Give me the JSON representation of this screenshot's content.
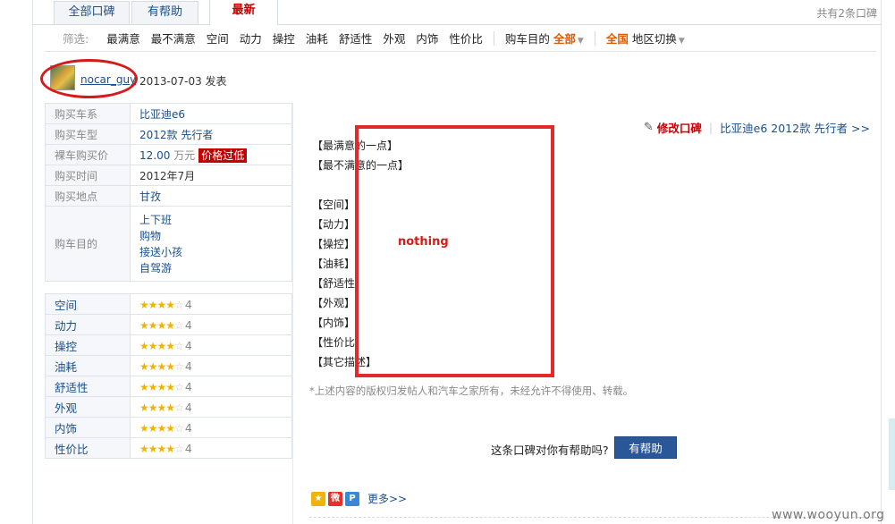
{
  "tabs": [
    {
      "label": "全部口碑",
      "active": false
    },
    {
      "label": "有帮助",
      "active": false
    },
    {
      "label": "最新",
      "active": true
    }
  ],
  "total_text": "共有2条口碑",
  "filter": {
    "label": "筛选:",
    "items": [
      "最满意",
      "最不满意",
      "空间",
      "动力",
      "操控",
      "油耗",
      "舒适性",
      "外观",
      "内饰",
      "性价比"
    ],
    "purpose_label": "购车目的",
    "purpose_value": "全部",
    "region_value": "全国",
    "region_switch": "地区切换"
  },
  "user": {
    "name": "nocar_guy",
    "date": "2013-07-03 发表"
  },
  "info": {
    "series_label": "购买车系",
    "series_value": "比亚迪e6",
    "model_label": "购买车型",
    "model_value": "2012款 先行者",
    "price_label": "裸车购买价",
    "price_value": "12.00",
    "price_unit": "万元",
    "price_badge": "价格过低",
    "time_label": "购买时间",
    "time_value": "2012年7月",
    "place_label": "购买地点",
    "place_value": "甘孜",
    "purpose_label": "购车目的",
    "purposes": [
      "上下班",
      "购物",
      "接送小孩",
      "自驾游"
    ]
  },
  "scores": [
    {
      "label": "空间",
      "value": 4
    },
    {
      "label": "动力",
      "value": 4
    },
    {
      "label": "操控",
      "value": 4
    },
    {
      "label": "油耗",
      "value": 4
    },
    {
      "label": "舒适性",
      "value": 4
    },
    {
      "label": "外观",
      "value": 4
    },
    {
      "label": "内饰",
      "value": 4
    },
    {
      "label": "性价比",
      "value": 4
    }
  ],
  "right": {
    "edit_label": "修改口碑",
    "model_link": "比亚迪e6 2012款 先行者 >>",
    "review_lines": [
      "【最满意的一点】",
      "【最不满意的一点】",
      "",
      "【空间】",
      "【动力】",
      "【操控】",
      "【油耗】",
      "【舒适性",
      "【外观】",
      "【内饰】",
      "【性价比",
      "【其它描述】"
    ],
    "annotation": "nothing",
    "copyright": "*上述内容的版权归发帖人和汽车之家所有，未经允许不得使用、转载。",
    "helpful_question": "这条口碑对你有帮助吗?",
    "helpful_button": "有帮助",
    "more": "更多>>"
  },
  "watermark": "www.wooyun.org",
  "colors": {
    "accent": "#c40000",
    "link": "#1a4f8a",
    "button": "#2a5797",
    "annotation": "#e12a2a"
  }
}
